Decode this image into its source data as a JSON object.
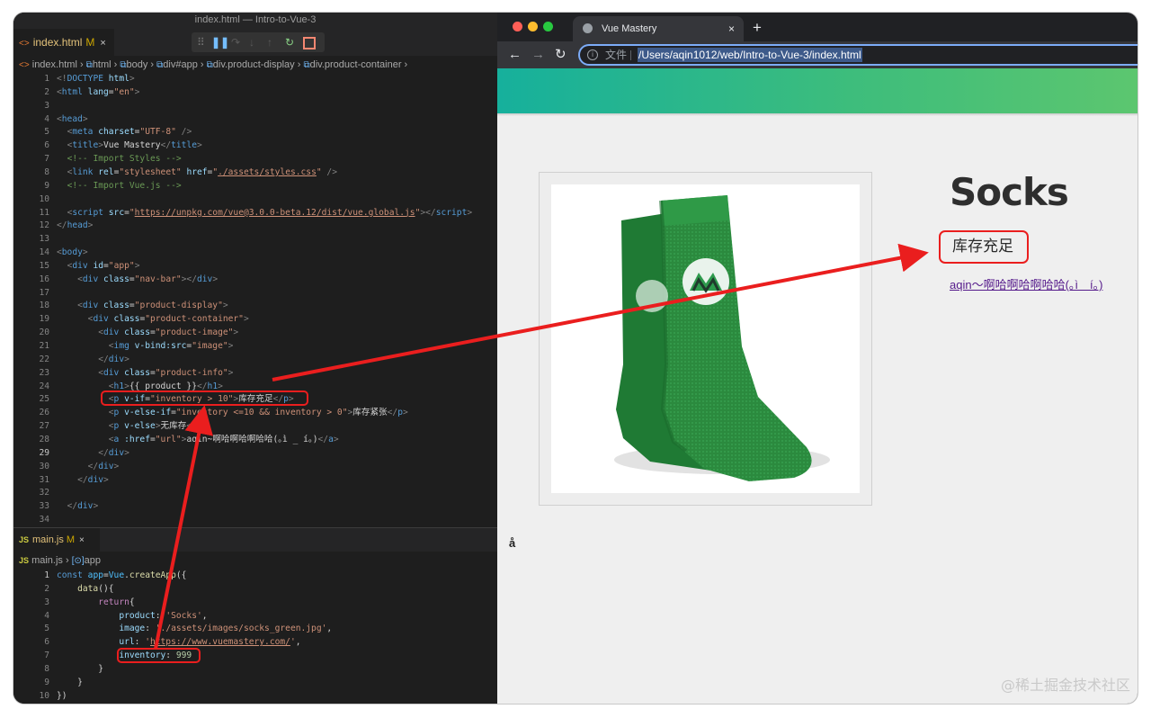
{
  "vscode": {
    "window_title": "index.html — Intro-to-Vue-3",
    "tab1": {
      "name": "index.html",
      "status": "M",
      "close": "×"
    },
    "tab2": {
      "name": "main.js",
      "status": "M",
      "close": "×"
    },
    "breadcrumb1": [
      "index.html",
      "html",
      "body",
      "div#app",
      "div.product-display",
      "div.product-container"
    ],
    "breadcrumb2": [
      "main.js",
      "app"
    ],
    "html_lines": [
      [
        [
          "t-br",
          "<!"
        ],
        [
          "t-tag",
          "DOCTYPE"
        ],
        [
          "t-txt",
          " "
        ],
        [
          "t-attr",
          "html"
        ],
        [
          "t-br",
          ">"
        ]
      ],
      [
        [
          "t-br",
          "<"
        ],
        [
          "t-tag",
          "html"
        ],
        [
          "t-txt",
          " "
        ],
        [
          "t-attr",
          "lang"
        ],
        [
          "t-txt",
          "="
        ],
        [
          "t-str",
          "\"en\""
        ],
        [
          "t-br",
          ">"
        ]
      ],
      [],
      [
        [
          "t-br",
          "<"
        ],
        [
          "t-tag",
          "head"
        ],
        [
          "t-br",
          ">"
        ]
      ],
      [
        [
          "t-txt",
          "  "
        ],
        [
          "t-br",
          "<"
        ],
        [
          "t-tag",
          "meta"
        ],
        [
          "t-txt",
          " "
        ],
        [
          "t-attr",
          "charset"
        ],
        [
          "t-txt",
          "="
        ],
        [
          "t-str",
          "\"UTF-8\""
        ],
        [
          "t-txt",
          " "
        ],
        [
          "t-br",
          "/>"
        ]
      ],
      [
        [
          "t-txt",
          "  "
        ],
        [
          "t-br",
          "<"
        ],
        [
          "t-tag",
          "title"
        ],
        [
          "t-br",
          ">"
        ],
        [
          "t-txt",
          "Vue Mastery"
        ],
        [
          "t-br",
          "</"
        ],
        [
          "t-tag",
          "title"
        ],
        [
          "t-br",
          ">"
        ]
      ],
      [
        [
          "t-txt",
          "  "
        ],
        [
          "t-com",
          "<!-- Import Styles -->"
        ]
      ],
      [
        [
          "t-txt",
          "  "
        ],
        [
          "t-br",
          "<"
        ],
        [
          "t-tag",
          "link"
        ],
        [
          "t-txt",
          " "
        ],
        [
          "t-attr",
          "rel"
        ],
        [
          "t-txt",
          "="
        ],
        [
          "t-str",
          "\"stylesheet\""
        ],
        [
          "t-txt",
          " "
        ],
        [
          "t-attr",
          "href"
        ],
        [
          "t-txt",
          "="
        ],
        [
          "t-str",
          "\""
        ],
        [
          "t-url",
          "./assets/styles.css"
        ],
        [
          "t-str",
          "\""
        ],
        [
          "t-txt",
          " "
        ],
        [
          "t-br",
          "/>"
        ]
      ],
      [
        [
          "t-txt",
          "  "
        ],
        [
          "t-com",
          "<!-- Import Vue.js -->"
        ]
      ],
      [],
      [
        [
          "t-txt",
          "  "
        ],
        [
          "t-br",
          "<"
        ],
        [
          "t-tag",
          "script"
        ],
        [
          "t-txt",
          " "
        ],
        [
          "t-attr",
          "src"
        ],
        [
          "t-txt",
          "="
        ],
        [
          "t-str",
          "\""
        ],
        [
          "t-url",
          "https://unpkg.com/vue@3.0.0-beta.12/dist/vue.global.js"
        ],
        [
          "t-str",
          "\""
        ],
        [
          "t-br",
          "></"
        ],
        [
          "t-tag",
          "script"
        ],
        [
          "t-br",
          ">"
        ]
      ],
      [
        [
          "t-br",
          "</"
        ],
        [
          "t-tag",
          "head"
        ],
        [
          "t-br",
          ">"
        ]
      ],
      [],
      [
        [
          "t-br",
          "<"
        ],
        [
          "t-tag",
          "body"
        ],
        [
          "t-br",
          ">"
        ]
      ],
      [
        [
          "t-txt",
          "  "
        ],
        [
          "t-br",
          "<"
        ],
        [
          "t-tag",
          "div"
        ],
        [
          "t-txt",
          " "
        ],
        [
          "t-attr",
          "id"
        ],
        [
          "t-txt",
          "="
        ],
        [
          "t-str",
          "\"app\""
        ],
        [
          "t-br",
          ">"
        ]
      ],
      [
        [
          "t-txt",
          "    "
        ],
        [
          "t-br",
          "<"
        ],
        [
          "t-tag",
          "div"
        ],
        [
          "t-txt",
          " "
        ],
        [
          "t-attr",
          "class"
        ],
        [
          "t-txt",
          "="
        ],
        [
          "t-str",
          "\"nav-bar\""
        ],
        [
          "t-br",
          "></"
        ],
        [
          "t-tag",
          "div"
        ],
        [
          "t-br",
          ">"
        ]
      ],
      [],
      [
        [
          "t-txt",
          "    "
        ],
        [
          "t-br",
          "<"
        ],
        [
          "t-tag",
          "div"
        ],
        [
          "t-txt",
          " "
        ],
        [
          "t-attr",
          "class"
        ],
        [
          "t-txt",
          "="
        ],
        [
          "t-str",
          "\"product-display\""
        ],
        [
          "t-br",
          ">"
        ]
      ],
      [
        [
          "t-txt",
          "      "
        ],
        [
          "t-br",
          "<"
        ],
        [
          "t-tag",
          "div"
        ],
        [
          "t-txt",
          " "
        ],
        [
          "t-attr",
          "class"
        ],
        [
          "t-txt",
          "="
        ],
        [
          "t-str",
          "\"product-container\""
        ],
        [
          "t-br",
          ">"
        ]
      ],
      [
        [
          "t-txt",
          "        "
        ],
        [
          "t-br",
          "<"
        ],
        [
          "t-tag",
          "div"
        ],
        [
          "t-txt",
          " "
        ],
        [
          "t-attr",
          "class"
        ],
        [
          "t-txt",
          "="
        ],
        [
          "t-str",
          "\"product-image\""
        ],
        [
          "t-br",
          ">"
        ]
      ],
      [
        [
          "t-txt",
          "          "
        ],
        [
          "t-br",
          "<"
        ],
        [
          "t-tag",
          "img"
        ],
        [
          "t-txt",
          " "
        ],
        [
          "t-attr",
          "v-bind:src"
        ],
        [
          "t-txt",
          "="
        ],
        [
          "t-str",
          "\"image\""
        ],
        [
          "t-br",
          ">"
        ]
      ],
      [
        [
          "t-txt",
          "        "
        ],
        [
          "t-br",
          "</"
        ],
        [
          "t-tag",
          "div"
        ],
        [
          "t-br",
          ">"
        ]
      ],
      [
        [
          "t-txt",
          "        "
        ],
        [
          "t-br",
          "<"
        ],
        [
          "t-tag",
          "div"
        ],
        [
          "t-txt",
          " "
        ],
        [
          "t-attr",
          "class"
        ],
        [
          "t-txt",
          "="
        ],
        [
          "t-str",
          "\"product-info\""
        ],
        [
          "t-br",
          ">"
        ]
      ],
      [
        [
          "t-txt",
          "          "
        ],
        [
          "t-br",
          "<"
        ],
        [
          "t-tag",
          "h1"
        ],
        [
          "t-br",
          ">"
        ],
        [
          "t-txt",
          "{{ product }}"
        ],
        [
          "t-br",
          "</"
        ],
        [
          "t-tag",
          "h1"
        ],
        [
          "t-br",
          ">"
        ]
      ],
      [
        [
          "t-txt",
          "          "
        ],
        [
          "t-br",
          "<"
        ],
        [
          "t-tag",
          "p"
        ],
        [
          "t-txt",
          " "
        ],
        [
          "t-attr",
          "v-if"
        ],
        [
          "t-txt",
          "="
        ],
        [
          "t-str",
          "\"inventory > 10\""
        ],
        [
          "t-br",
          ">"
        ],
        [
          "t-txt",
          "库存充足"
        ],
        [
          "t-br",
          "</"
        ],
        [
          "t-tag",
          "p"
        ],
        [
          "t-br",
          ">"
        ]
      ],
      [
        [
          "t-txt",
          "          "
        ],
        [
          "t-br",
          "<"
        ],
        [
          "t-tag",
          "p"
        ],
        [
          "t-txt",
          " "
        ],
        [
          "t-attr",
          "v-else-if"
        ],
        [
          "t-txt",
          "="
        ],
        [
          "t-str",
          "\"inventory <=10 && inventory > 0\""
        ],
        [
          "t-br",
          ">"
        ],
        [
          "t-txt",
          "库存紧张"
        ],
        [
          "t-br",
          "</"
        ],
        [
          "t-tag",
          "p"
        ],
        [
          "t-br",
          ">"
        ]
      ],
      [
        [
          "t-txt",
          "          "
        ],
        [
          "t-br",
          "<"
        ],
        [
          "t-tag",
          "p"
        ],
        [
          "t-txt",
          " "
        ],
        [
          "t-attr",
          "v-else"
        ],
        [
          "t-br",
          ">"
        ],
        [
          "t-txt",
          "无库存"
        ],
        [
          "t-br",
          "</"
        ],
        [
          "t-tag",
          "p"
        ],
        [
          "t-br",
          ">"
        ]
      ],
      [
        [
          "t-txt",
          "          "
        ],
        [
          "t-br",
          "<"
        ],
        [
          "t-tag",
          "a"
        ],
        [
          "t-txt",
          " "
        ],
        [
          "t-attr",
          ":href"
        ],
        [
          "t-txt",
          "="
        ],
        [
          "t-str",
          "\"url\""
        ],
        [
          "t-br",
          ">"
        ],
        [
          "t-txt",
          "aqin~啊哈啊哈啊哈哈(｡ì _ í｡)"
        ],
        [
          "t-br",
          "</"
        ],
        [
          "t-tag",
          "a"
        ],
        [
          "t-br",
          ">"
        ]
      ],
      [
        [
          "t-txt",
          "        "
        ],
        [
          "t-br",
          "</"
        ],
        [
          "t-tag",
          "div"
        ],
        [
          "t-br",
          ">"
        ]
      ],
      [
        [
          "t-txt",
          "      "
        ],
        [
          "t-br",
          "</"
        ],
        [
          "t-tag",
          "div"
        ],
        [
          "t-br",
          ">"
        ]
      ],
      [
        [
          "t-txt",
          "    "
        ],
        [
          "t-br",
          "</"
        ],
        [
          "t-tag",
          "div"
        ],
        [
          "t-br",
          ">"
        ]
      ],
      [],
      [
        [
          "t-txt",
          "  "
        ],
        [
          "t-br",
          "</"
        ],
        [
          "t-tag",
          "div"
        ],
        [
          "t-br",
          ">"
        ]
      ],
      []
    ],
    "js_lines": [
      [
        [
          "t-kw",
          "const"
        ],
        [
          "t-txt",
          " "
        ],
        [
          "t-var",
          "app"
        ],
        [
          "t-txt",
          "="
        ],
        [
          "t-var",
          "Vue"
        ],
        [
          "t-txt",
          "."
        ],
        [
          "t-fn",
          "createApp"
        ],
        [
          "t-txt",
          "({"
        ]
      ],
      [
        [
          "t-txt",
          "    "
        ],
        [
          "t-fn",
          "data"
        ],
        [
          "t-txt",
          "(){"
        ]
      ],
      [
        [
          "t-txt",
          "        "
        ],
        [
          "t-kw2",
          "return"
        ],
        [
          "t-txt",
          "{"
        ]
      ],
      [
        [
          "t-txt",
          "            "
        ],
        [
          "t-attr",
          "product"
        ],
        [
          "t-txt",
          ": "
        ],
        [
          "t-str",
          "'Socks'"
        ],
        [
          "t-txt",
          ","
        ]
      ],
      [
        [
          "t-txt",
          "            "
        ],
        [
          "t-attr",
          "image"
        ],
        [
          "t-txt",
          ": "
        ],
        [
          "t-str",
          "'./assets/images/socks_green.jpg'"
        ],
        [
          "t-txt",
          ","
        ]
      ],
      [
        [
          "t-txt",
          "            "
        ],
        [
          "t-attr",
          "url"
        ],
        [
          "t-txt",
          ": "
        ],
        [
          "t-str",
          "'"
        ],
        [
          "t-url",
          "https://www.vuemastery.com/"
        ],
        [
          "t-str",
          "'"
        ],
        [
          "t-txt",
          ","
        ]
      ],
      [
        [
          "t-txt",
          "            "
        ],
        [
          "t-attr",
          "inventory"
        ],
        [
          "t-txt",
          ": "
        ],
        [
          "t-num",
          "999"
        ]
      ],
      [
        [
          "t-txt",
          "        }"
        ]
      ],
      [
        [
          "t-txt",
          "    }"
        ]
      ],
      [
        [
          "t-txt",
          "})"
        ]
      ]
    ]
  },
  "browser": {
    "tab_title": "Vue Mastery",
    "tab_close": "×",
    "new_tab": "+",
    "address_label": "文件",
    "address_url": "/Users/aqin1012/web/Intro-to-Vue-3/index.html",
    "product_title": "Socks",
    "stock_status": "库存充足",
    "link_text": "aqin～啊哈啊哈啊哈哈(｡ì＿í｡)",
    "stray_char": "å"
  },
  "watermark": "@稀土掘金技术社区",
  "colors": {
    "annotation_red": "#ea1e1e",
    "navbar_start": "#16b09c",
    "navbar_end": "#5cc66f",
    "link": "#551a8b"
  }
}
